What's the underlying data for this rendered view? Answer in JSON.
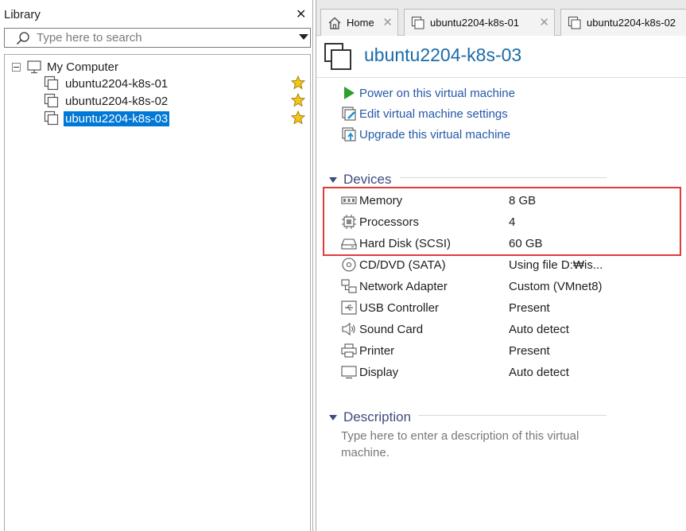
{
  "library": {
    "title": "Library",
    "close_glyph": "✕",
    "search": {
      "placeholder": "Type here to search"
    },
    "root": {
      "label": "My Computer"
    },
    "vms": [
      {
        "label": "ubuntu2204-k8s-01",
        "favorite": true,
        "selected": false
      },
      {
        "label": "ubuntu2204-k8s-02",
        "favorite": true,
        "selected": false
      },
      {
        "label": "ubuntu2204-k8s-03",
        "favorite": true,
        "selected": true
      }
    ]
  },
  "tabs": [
    {
      "label": "Home",
      "icon": "home-icon"
    },
    {
      "label": "ubuntu2204-k8s-01",
      "icon": "vm-icon"
    },
    {
      "label": "ubuntu2204-k8s-02",
      "icon": "vm-icon"
    }
  ],
  "vm": {
    "title": "ubuntu2204-k8s-03",
    "actions": [
      {
        "label": "Power on this virtual machine",
        "icon": "play-icon"
      },
      {
        "label": "Edit virtual machine settings",
        "icon": "edit-settings-icon"
      },
      {
        "label": "Upgrade this virtual machine",
        "icon": "upgrade-icon"
      }
    ],
    "devices_heading": "Devices",
    "devices": [
      {
        "name": "Memory",
        "value": "8 GB",
        "icon": "memory-icon"
      },
      {
        "name": "Processors",
        "value": "4",
        "icon": "processor-icon"
      },
      {
        "name": "Hard Disk (SCSI)",
        "value": "60 GB",
        "icon": "hard-disk-icon"
      },
      {
        "name": "CD/DVD (SATA)",
        "value": "Using file D:₩is...",
        "icon": "cd-dvd-icon"
      },
      {
        "name": "Network Adapter",
        "value": "Custom (VMnet8)",
        "icon": "network-adapter-icon"
      },
      {
        "name": "USB Controller",
        "value": "Present",
        "icon": "usb-icon"
      },
      {
        "name": "Sound Card",
        "value": "Auto detect",
        "icon": "speaker-icon"
      },
      {
        "name": "Printer",
        "value": "Present",
        "icon": "printer-icon"
      },
      {
        "name": "Display",
        "value": "Auto detect",
        "icon": "display-icon"
      }
    ],
    "description_heading": "Description",
    "description_placeholder": "Type here to enter a description of this virtual machine."
  },
  "colors": {
    "selection": "#0078d7",
    "title_blue": "#1a6aa8",
    "link_blue": "#2558a8",
    "section_heading": "#3f4a7c",
    "highlight_red": "#e23a3a",
    "star_gold": "#f5c518"
  }
}
